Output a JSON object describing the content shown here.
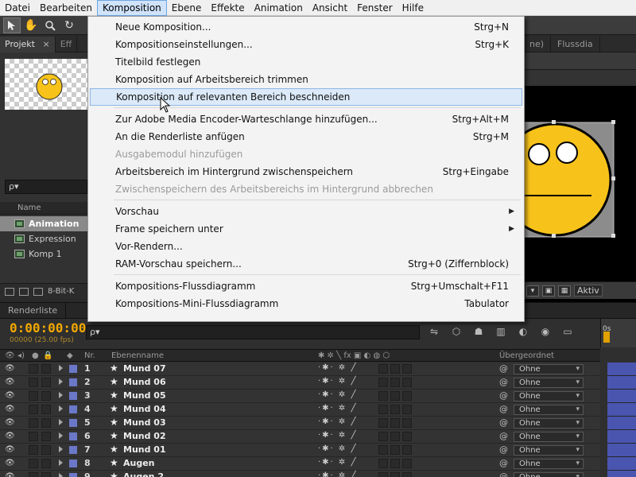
{
  "menubar": {
    "items": [
      {
        "label": "Datei",
        "active": false
      },
      {
        "label": "Bearbeiten",
        "active": false
      },
      {
        "label": "Komposition",
        "active": true
      },
      {
        "label": "Ebene",
        "active": false
      },
      {
        "label": "Effekte",
        "active": false
      },
      {
        "label": "Animation",
        "active": false
      },
      {
        "label": "Ansicht",
        "active": false
      },
      {
        "label": "Fenster",
        "active": false
      },
      {
        "label": "Hilfe",
        "active": false
      }
    ]
  },
  "project_panel": {
    "tab_label": "Projekt",
    "close_glyph": "×",
    "second_tab_label": "Eff",
    "search_placeholder": "ρ▾",
    "column_name": "Name",
    "items": [
      {
        "label": "Animation",
        "selected": true
      },
      {
        "label": "Expression",
        "selected": false
      },
      {
        "label": "Komp 1",
        "selected": false
      }
    ],
    "bit_depth": "8-Bit-K"
  },
  "viewer": {
    "tab1": "ne)",
    "tab2": "Flussdia",
    "footer_label": "Aktiv"
  },
  "timeline": {
    "tab_label": "Renderliste",
    "timecode": "0:00:00:00",
    "timecode_sub": "00000 (25.00 fps)",
    "search_placeholder": "ρ▾",
    "ruler_label": "0s",
    "columns": {
      "nr": "Nr.",
      "layer_name": "Ebenenname",
      "parent": "Übergeordnet"
    },
    "layers": [
      {
        "num": "1",
        "name": "Mund 07",
        "parent": "Ohne"
      },
      {
        "num": "2",
        "name": "Mund 06",
        "parent": "Ohne"
      },
      {
        "num": "3",
        "name": "Mund 05",
        "parent": "Ohne"
      },
      {
        "num": "4",
        "name": "Mund 04",
        "parent": "Ohne"
      },
      {
        "num": "5",
        "name": "Mund 03",
        "parent": "Ohne"
      },
      {
        "num": "6",
        "name": "Mund 02",
        "parent": "Ohne"
      },
      {
        "num": "7",
        "name": "Mund 01",
        "parent": "Ohne"
      },
      {
        "num": "8",
        "name": "Augen",
        "parent": "Ohne"
      },
      {
        "num": "9",
        "name": "Augen 2",
        "parent": "Ohne"
      }
    ]
  },
  "dropdown": {
    "items": [
      {
        "label": "Neue Komposition...",
        "shortcut": "Strg+N",
        "disabled": false
      },
      {
        "label": "Kompositionseinstellungen...",
        "shortcut": "Strg+K",
        "disabled": false
      },
      {
        "label": "Titelbild festlegen",
        "shortcut": "",
        "disabled": false
      },
      {
        "label": "Komposition auf Arbeitsbereich trimmen",
        "shortcut": "",
        "disabled": false
      },
      {
        "label": "Komposition auf relevanten Bereich beschneiden",
        "shortcut": "",
        "disabled": false,
        "hover": true
      },
      {
        "label": "Zur Adobe Media Encoder-Warteschlange hinzufügen...",
        "shortcut": "Strg+Alt+M",
        "disabled": false
      },
      {
        "label": "An die Renderliste anfügen",
        "shortcut": "Strg+M",
        "disabled": false
      },
      {
        "label": "Ausgabemodul hinzufügen",
        "shortcut": "",
        "disabled": true
      },
      {
        "label": "Arbeitsbereich im Hintergrund zwischenspeichern",
        "shortcut": "Strg+Eingabe",
        "disabled": false
      },
      {
        "label": "Zwischenspeichern des Arbeitsbereichs im Hintergrund abbrechen",
        "shortcut": "",
        "disabled": true
      },
      {
        "label": "Vorschau",
        "shortcut": "",
        "disabled": false,
        "submenu": true
      },
      {
        "label": "Frame speichern unter",
        "shortcut": "",
        "disabled": false,
        "submenu": true
      },
      {
        "label": "Vor-Rendern...",
        "shortcut": "",
        "disabled": false
      },
      {
        "label": "RAM-Vorschau speichern...",
        "shortcut": "Strg+0 (Ziffernblock)",
        "disabled": false
      },
      {
        "label": "Kompositions-Flussdiagramm",
        "shortcut": "Strg+Umschalt+F11",
        "disabled": false
      },
      {
        "label": "Kompositions-Mini-Flussdiagramm",
        "shortcut": "Tabulator",
        "disabled": false
      }
    ]
  },
  "colors": {
    "accent": "#f0a800",
    "layer_label": "#6b78c8",
    "smiley_yellow": "#f7c21a"
  }
}
